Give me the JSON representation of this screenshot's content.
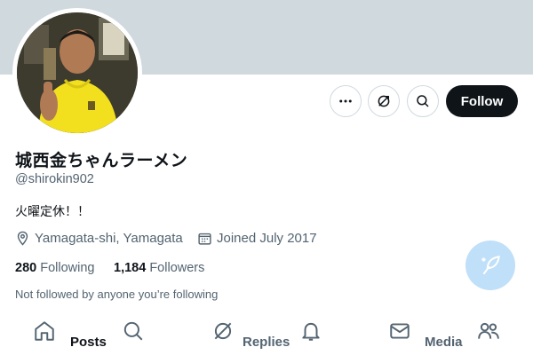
{
  "profile": {
    "display_name": "城西金ちゃんラーメン",
    "handle": "@shirokin902",
    "bio": "火曜定休！！",
    "location": "Yamagata-shi, Yamagata",
    "joined": "Joined July 2017",
    "following_count": "280",
    "following_label": "Following",
    "followers_count": "1,184",
    "followers_label": "Followers",
    "not_followed_text": "Not followed by anyone you’re following"
  },
  "actions": {
    "follow_label": "Follow",
    "icons": [
      "more-icon",
      "subscribe-icon",
      "search-icon"
    ]
  },
  "tabs": {
    "posts": "Posts",
    "replies": "Replies",
    "media": "Media"
  },
  "nav_icons": [
    "home-icon",
    "explore-icon",
    "grok-icon",
    "notifications-icon",
    "messages-icon",
    "communities-icon"
  ],
  "colors": {
    "banner": "#cfd9de",
    "follow_button": "#0f1419",
    "secondary_text": "#536471",
    "compose_fab": "#bfe0f8"
  }
}
